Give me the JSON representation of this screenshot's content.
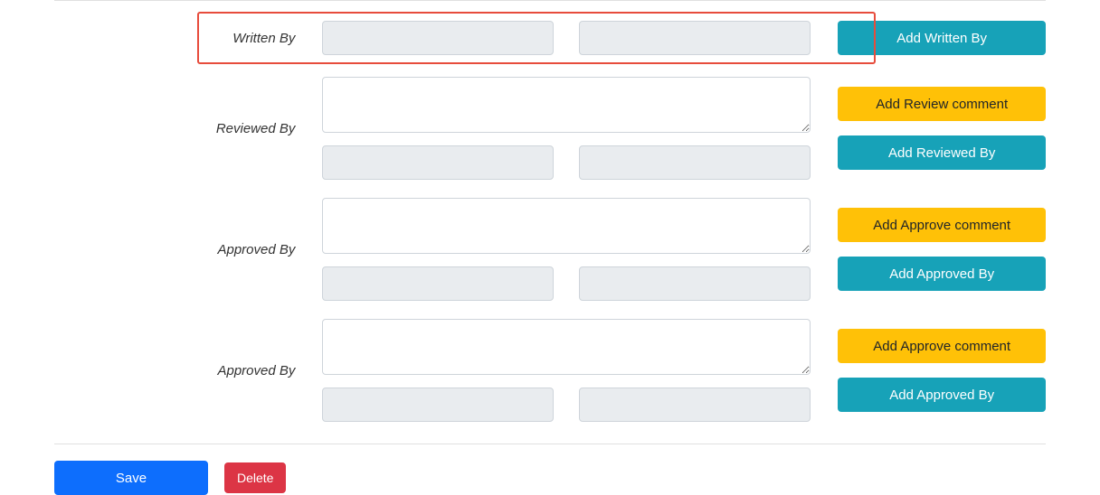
{
  "sections": {
    "writtenBy": {
      "label": "Written By",
      "addButton": "Add Written By"
    },
    "reviewedBy": {
      "label": "Reviewed By",
      "commentButton": "Add Review comment",
      "addButton": "Add Reviewed By"
    },
    "approvedBy1": {
      "label": "Approved By",
      "commentButton": "Add Approve comment",
      "addButton": "Add Approved By"
    },
    "approvedBy2": {
      "label": "Approved By",
      "commentButton": "Add Approve comment",
      "addButton": "Add Approved By"
    }
  },
  "footer": {
    "save": "Save",
    "delete": "Delete"
  }
}
